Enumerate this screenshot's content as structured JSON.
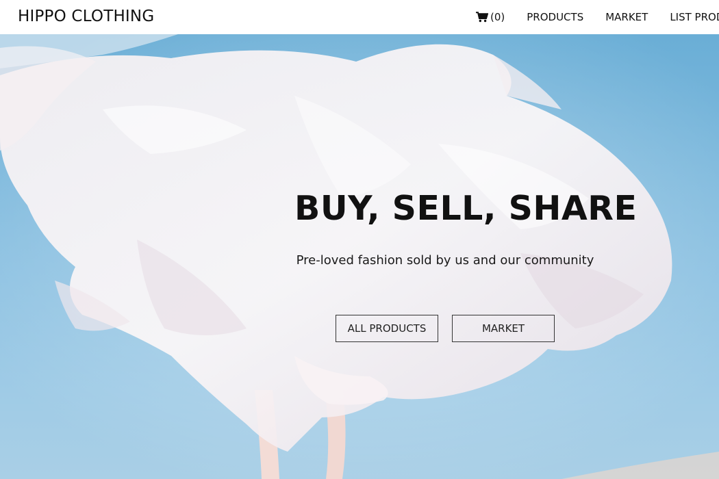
{
  "brand": "HIPPO CLOTHING",
  "nav": {
    "cart_count": "(0)",
    "products": "PRODUCTS",
    "market": "MARKET",
    "list_products": "LIST PROD"
  },
  "hero": {
    "title": "BUY, SELL, SHARE",
    "subtitle": "Pre-loved fashion sold by us and our community",
    "buttons": {
      "all_products": "ALL PRODUCTS",
      "market": "MARKET"
    }
  },
  "icons": {
    "cart": "shopping-cart-icon"
  },
  "colors": {
    "sky": "#7bb8dd",
    "fabric": "#f4ecef",
    "text": "#111111"
  }
}
